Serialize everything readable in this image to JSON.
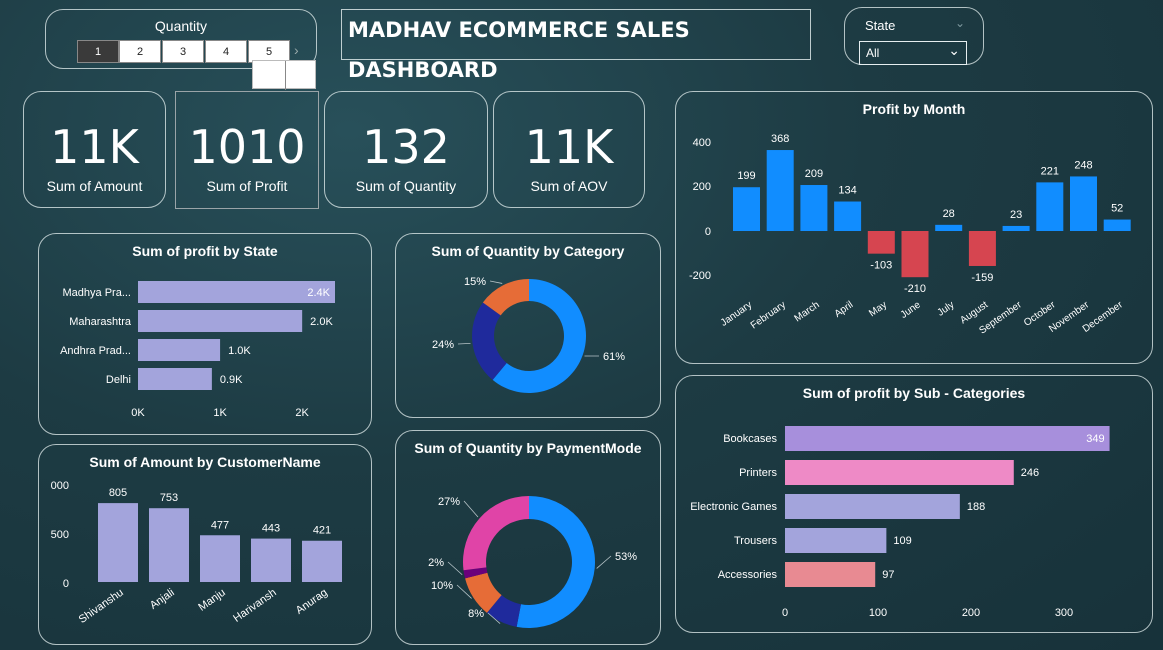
{
  "dashboard_title": "MADHAV ECOMMERCE SALES DASHBOARD",
  "quantity_slicer": {
    "label": "Quantity",
    "pages": [
      {
        "label": "1",
        "active": true
      },
      {
        "label": "2",
        "active": false
      },
      {
        "label": "3",
        "active": false
      },
      {
        "label": "4",
        "active": false
      },
      {
        "label": "5",
        "active": false
      }
    ],
    "next_icon": "chevron-right-icon"
  },
  "state_filter": {
    "label": "State",
    "selected": "All",
    "dropdown_icon": "chevron-down-icon"
  },
  "kpis": [
    {
      "value": "11K",
      "label": "Sum of Amount"
    },
    {
      "value": "1010",
      "label": "Sum of Profit"
    },
    {
      "value": "132",
      "label": "Sum of Quantity"
    },
    {
      "value": "11K",
      "label": "Sum of AOV"
    }
  ],
  "profit_by_state": {
    "title": "Sum of profit by State",
    "chart_data": {
      "type": "bar",
      "orientation": "horizontal",
      "categories": [
        "Madhya Pra...",
        "Maharashtra",
        "Andhra Prad...",
        "Delhi"
      ],
      "values": [
        2400,
        2000,
        1000,
        900
      ],
      "labels": [
        "2.4K",
        "2.0K",
        "1.0K",
        "0.9K"
      ],
      "xticks": [
        "0K",
        "1K",
        "2K"
      ],
      "xlim": [
        0,
        2400
      ],
      "color": "#a3a4dc"
    }
  },
  "quantity_by_category": {
    "title": "Sum of Quantity by Category",
    "chart_data": {
      "type": "pie",
      "donut": true,
      "values": [
        61,
        24,
        15
      ],
      "labels": [
        "61%",
        "24%",
        "15%"
      ],
      "colors": [
        "#118dff",
        "#1f2a9c",
        "#e66c37"
      ]
    }
  },
  "quantity_by_paymentmode": {
    "title": "Sum of Quantity by PaymentMode",
    "chart_data": {
      "type": "pie",
      "donut": true,
      "values": [
        53,
        8,
        10,
        2,
        27
      ],
      "labels": [
        "53%",
        "8%",
        "10%",
        "2%",
        "27%"
      ],
      "colors": [
        "#118dff",
        "#1f2a9c",
        "#e66c37",
        "#6b007b",
        "#e044a7"
      ]
    }
  },
  "amount_by_customer": {
    "title": "Sum of Amount by CustomerName",
    "chart_data": {
      "type": "bar",
      "categories": [
        "Shivanshu",
        "Anjali",
        "Manju",
        "Harivansh",
        "Anurag"
      ],
      "values": [
        805,
        753,
        477,
        443,
        421
      ],
      "yticks": [
        "000",
        "500",
        "0"
      ],
      "ylim": [
        0,
        1000
      ],
      "color": "#a3a4dc"
    }
  },
  "profit_by_month": {
    "title": "Profit by Month",
    "chart_data": {
      "type": "bar",
      "categories": [
        "January",
        "February",
        "March",
        "April",
        "May",
        "June",
        "July",
        "August",
        "September",
        "October",
        "November",
        "December"
      ],
      "values": [
        199,
        368,
        209,
        134,
        -103,
        -210,
        28,
        -159,
        23,
        221,
        248,
        52
      ],
      "yticks": [
        "400",
        "200",
        "0",
        "-200"
      ],
      "ylim": [
        -200,
        400
      ],
      "positive_color": "#118dff",
      "negative_color": "#d64550"
    }
  },
  "profit_by_subcategory": {
    "title": "Sum of profit by Sub - Categories",
    "chart_data": {
      "type": "bar",
      "orientation": "horizontal",
      "categories": [
        "Bookcases",
        "Printers",
        "Electronic Games",
        "Trousers",
        "Accessories"
      ],
      "values": [
        349,
        246,
        188,
        109,
        97
      ],
      "xticks": [
        "0",
        "100",
        "200",
        "300"
      ],
      "xlim": [
        0,
        300
      ],
      "colors": [
        "#a78fdc",
        "#ee8ac6",
        "#a3a4dc",
        "#a3a4dc",
        "#e88a92"
      ]
    }
  }
}
